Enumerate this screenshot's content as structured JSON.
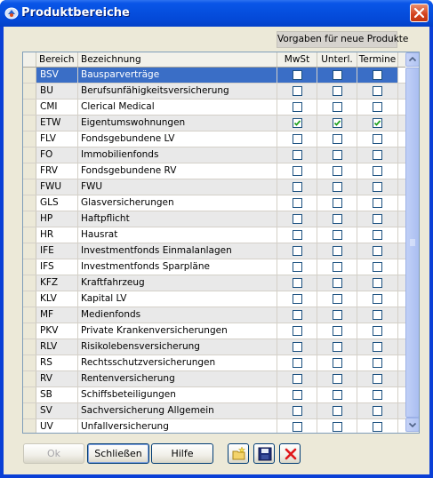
{
  "window": {
    "title": "Produktbereiche",
    "icon": "app-icon",
    "close_icon": "close-icon"
  },
  "vorgaben_label": "Vorgaben für neue Produkte",
  "table": {
    "columns": {
      "code": "Bereich",
      "name": "Bezeichnung",
      "mwst": "MwSt",
      "unterl": "Unterl.",
      "termine": "Termine"
    },
    "selected_row": 0,
    "rows": [
      {
        "code": "BSV",
        "name": "Bausparverträge",
        "mwst": false,
        "unterl": false,
        "termine": false
      },
      {
        "code": "BU",
        "name": "Berufsunfähigkeitsversicherung",
        "mwst": false,
        "unterl": false,
        "termine": false
      },
      {
        "code": "CMI",
        "name": "Clerical Medical",
        "mwst": false,
        "unterl": false,
        "termine": false
      },
      {
        "code": "ETW",
        "name": "Eigentumswohnungen",
        "mwst": true,
        "unterl": true,
        "termine": true
      },
      {
        "code": "FLV",
        "name": "Fondsgebundene LV",
        "mwst": false,
        "unterl": false,
        "termine": false
      },
      {
        "code": "FO",
        "name": "Immobilienfonds",
        "mwst": false,
        "unterl": false,
        "termine": false
      },
      {
        "code": "FRV",
        "name": "Fondsgebundene RV",
        "mwst": false,
        "unterl": false,
        "termine": false
      },
      {
        "code": "FWU",
        "name": "FWU",
        "mwst": false,
        "unterl": false,
        "termine": false
      },
      {
        "code": "GLS",
        "name": "Glasversicherungen",
        "mwst": false,
        "unterl": false,
        "termine": false
      },
      {
        "code": "HP",
        "name": "Haftpflicht",
        "mwst": false,
        "unterl": false,
        "termine": false
      },
      {
        "code": "HR",
        "name": "Hausrat",
        "mwst": false,
        "unterl": false,
        "termine": false
      },
      {
        "code": "IFE",
        "name": "Investmentfonds Einmalanlagen",
        "mwst": false,
        "unterl": false,
        "termine": false
      },
      {
        "code": "IFS",
        "name": "Investmentfonds Sparpläne",
        "mwst": false,
        "unterl": false,
        "termine": false
      },
      {
        "code": "KFZ",
        "name": "Kraftfahrzeug",
        "mwst": false,
        "unterl": false,
        "termine": false
      },
      {
        "code": "KLV",
        "name": "Kapital LV",
        "mwst": false,
        "unterl": false,
        "termine": false
      },
      {
        "code": "MF",
        "name": "Medienfonds",
        "mwst": false,
        "unterl": false,
        "termine": false
      },
      {
        "code": "PKV",
        "name": "Private Krankenversicherungen",
        "mwst": false,
        "unterl": false,
        "termine": false
      },
      {
        "code": "RLV",
        "name": "Risikolebensversicherung",
        "mwst": false,
        "unterl": false,
        "termine": false
      },
      {
        "code": "RS",
        "name": "Rechtsschutzversicherungen",
        "mwst": false,
        "unterl": false,
        "termine": false
      },
      {
        "code": "RV",
        "name": "Rentenversicherung",
        "mwst": false,
        "unterl": false,
        "termine": false
      },
      {
        "code": "SB",
        "name": "Schiffsbeteiligungen",
        "mwst": false,
        "unterl": false,
        "termine": false
      },
      {
        "code": "SV",
        "name": "Sachversicherung Allgemein",
        "mwst": false,
        "unterl": false,
        "termine": false
      },
      {
        "code": "UV",
        "name": "Unfallversicherung",
        "mwst": false,
        "unterl": false,
        "termine": false
      }
    ]
  },
  "buttons": {
    "ok": "Ok",
    "close": "Schließen",
    "help": "Hilfe"
  },
  "toolbar": {
    "new_icon": "new-folder-icon",
    "save_icon": "save-disk-icon",
    "delete_icon": "delete-x-icon"
  },
  "colors": {
    "selection": "#3a6ec6",
    "check": "#21a121",
    "titlebar": "#0650e0"
  }
}
